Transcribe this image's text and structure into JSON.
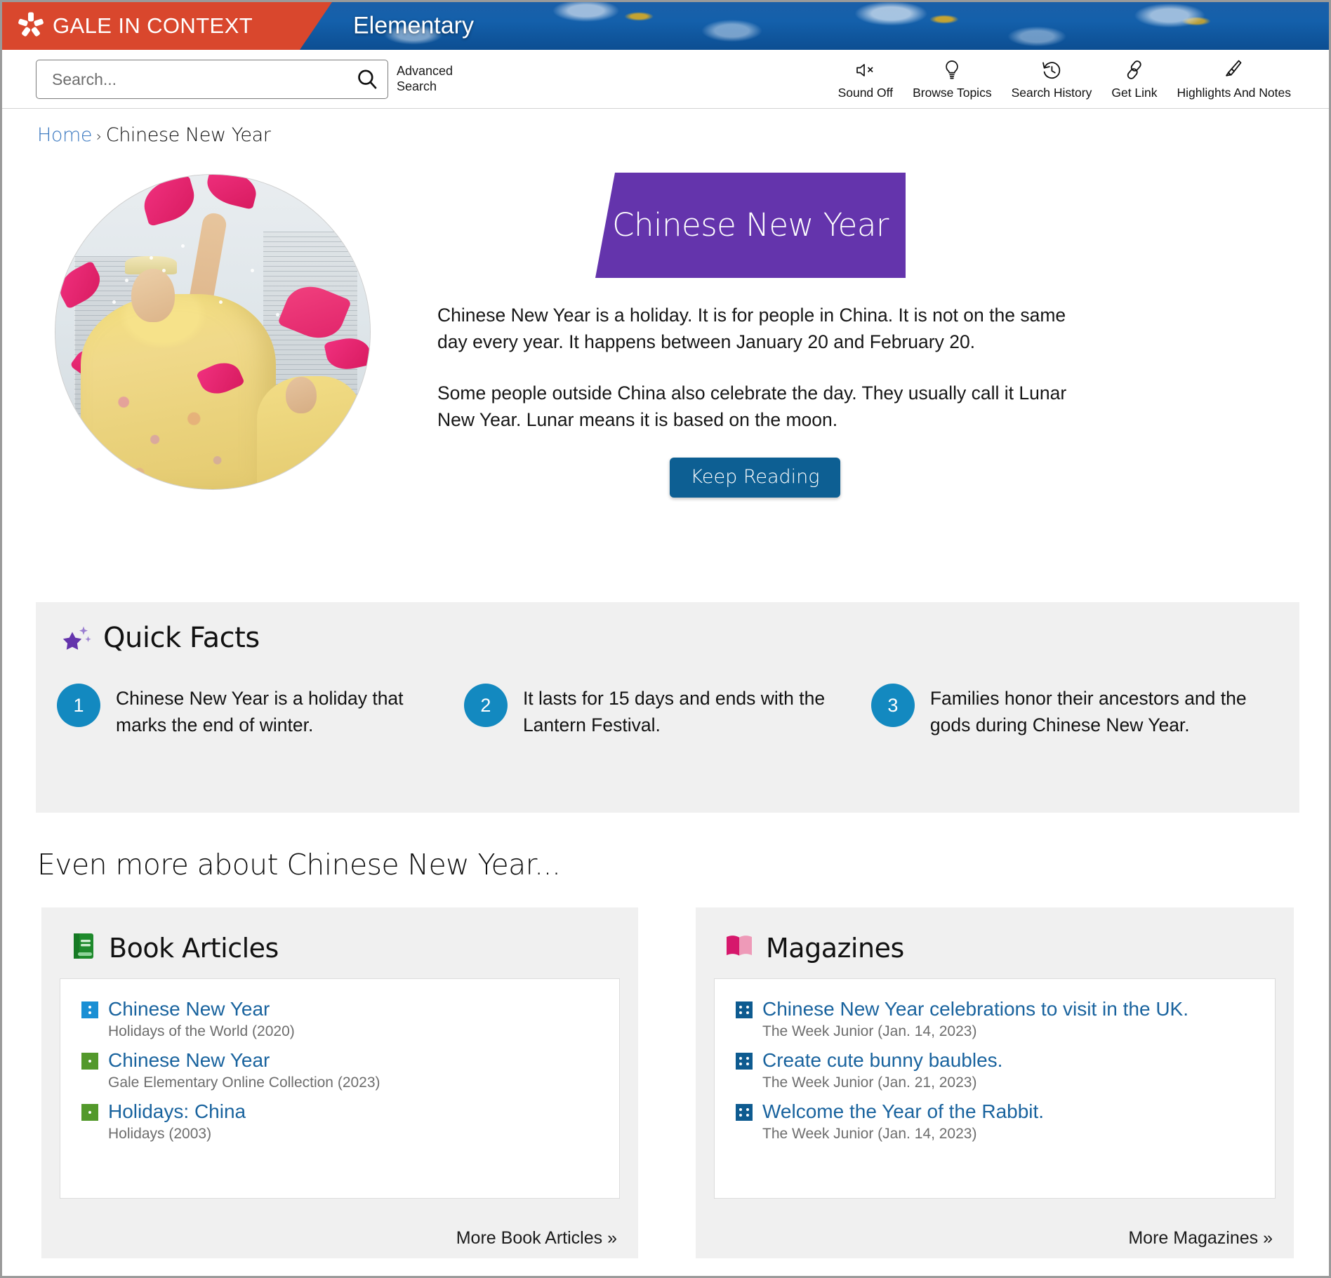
{
  "header": {
    "brand": "GALE IN CONTEXT",
    "product": "Elementary",
    "logo_icon": "gale-pinwheel-icon",
    "brand_color": "#d9472d",
    "banner_color": "#0d57a0"
  },
  "search": {
    "placeholder": "Search...",
    "value": "",
    "icon": "search-icon",
    "advanced_label": "Advanced\nSearch",
    "advanced_line1": "Advanced",
    "advanced_line2": "Search"
  },
  "tools": [
    {
      "label": "Sound Off",
      "icon": "speaker-mute-icon"
    },
    {
      "label": "Browse Topics",
      "icon": "lightbulb-icon"
    },
    {
      "label": "Search History",
      "icon": "clock-rewind-icon"
    },
    {
      "label": "Get Link",
      "icon": "link-chain-icon"
    },
    {
      "label": "Highlights And Notes",
      "icon": "highlighter-pen-icon"
    }
  ],
  "breadcrumb": {
    "home": "Home",
    "separator": "›",
    "current": "Chinese New Year"
  },
  "hero": {
    "image_alt": "Dancers in yellow costumes with pink fans at a Chinese New Year parade",
    "title": "Chinese New Year",
    "title_bg": "#6434ac",
    "paragraphs": [
      "Chinese New Year is a holiday. It is for people in China. It is not on the same day every year. It happens between January 20 and February 20.",
      "Some people outside China also celebrate the day. They usually call it Lunar New Year. Lunar means it is based on the moon."
    ],
    "keep_reading_label": "Keep Reading",
    "keep_reading_color": "#0d5f93"
  },
  "quick_facts": {
    "heading": "Quick Facts",
    "icon": "sparkle-star-icon",
    "icon_color": "#6434ac",
    "bullet_color": "#1389c0",
    "items": [
      {
        "number": "1",
        "text": "Chinese New Year is a holiday that marks the end of winter."
      },
      {
        "number": "2",
        "text": "It lasts for 15 days and ends with the Lantern Festival."
      },
      {
        "number": "3",
        "text": "Families honor their ancestors and the gods during Chinese New Year."
      }
    ]
  },
  "even_more": {
    "heading": "Even more about Chinese New Year..."
  },
  "panels": [
    {
      "key": "books",
      "title": "Book Articles",
      "icon": "closed-book-icon",
      "icon_color": "#1e8a2c",
      "more_label": "More Book Articles »",
      "items": [
        {
          "title": "Chinese New Year",
          "source": "Holidays of the World (2020)",
          "icon": "document-icon",
          "icon_variant": "blue"
        },
        {
          "title": "Chinese New Year",
          "source": "Gale Elementary Online Collection (2023)",
          "icon": "document-icon",
          "icon_variant": "green"
        },
        {
          "title": "Holidays: China",
          "source": "Holidays (2003)",
          "icon": "document-icon",
          "icon_variant": "green"
        }
      ]
    },
    {
      "key": "mags",
      "title": "Magazines",
      "icon": "open-book-icon",
      "icon_color": "#d6186c",
      "more_label": "More Magazines »",
      "items": [
        {
          "title": "Chinese New Year celebrations to visit in the UK.",
          "source": "The Week Junior (Jan. 14, 2023)",
          "icon": "document-icon",
          "icon_variant": "navy"
        },
        {
          "title": "Create cute bunny baubles.",
          "source": "The Week Junior (Jan. 21, 2023)",
          "icon": "document-icon",
          "icon_variant": "navy"
        },
        {
          "title": "Welcome the Year of the Rabbit.",
          "source": "The Week Junior (Jan. 14, 2023)",
          "icon": "document-icon",
          "icon_variant": "navy"
        }
      ]
    }
  ]
}
